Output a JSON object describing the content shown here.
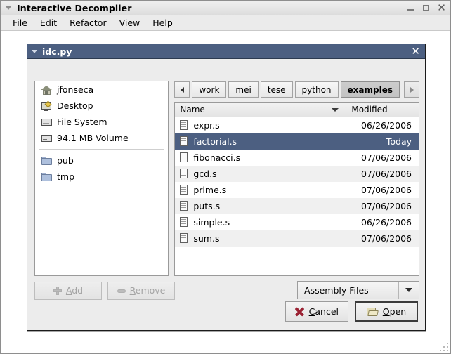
{
  "app": {
    "title": "Interactive Decompiler",
    "menu": [
      {
        "label": "File",
        "mnemonic": "F",
        "rest": "ile"
      },
      {
        "label": "Edit",
        "mnemonic": "E",
        "rest": "dit"
      },
      {
        "label": "Refactor",
        "mnemonic": "R",
        "rest": "efactor"
      },
      {
        "label": "View",
        "mnemonic": "V",
        "rest": "iew"
      },
      {
        "label": "Help",
        "mnemonic": "H",
        "rest": "elp"
      }
    ],
    "window_controls": {
      "minimize": "minimize-button",
      "maximize": "maximize-button",
      "close": "✕"
    }
  },
  "dialog": {
    "title": "idc.py",
    "close_label": "✕",
    "places": [
      {
        "label": "jfonseca",
        "icon": "home-icon"
      },
      {
        "label": "Desktop",
        "icon": "desktop-icon"
      },
      {
        "label": "File System",
        "icon": "filesystem-icon"
      },
      {
        "label": "94.1 MB Volume",
        "icon": "volume-icon"
      },
      {
        "label": "pub",
        "icon": "folder-icon"
      },
      {
        "label": "tmp",
        "icon": "folder-icon"
      }
    ],
    "breadcrumb": {
      "prev_label": "◀",
      "next_label": "▶",
      "crumbs": [
        {
          "label": "work",
          "active": false
        },
        {
          "label": "mei",
          "active": false
        },
        {
          "label": "tese",
          "active": false
        },
        {
          "label": "python",
          "active": false
        },
        {
          "label": "examples",
          "active": true
        }
      ]
    },
    "columns": {
      "name": "Name",
      "modified": "Modified"
    },
    "files": [
      {
        "name": "expr.s",
        "modified": "06/26/2006",
        "selected": false
      },
      {
        "name": "factorial.s",
        "modified": "Today",
        "selected": true
      },
      {
        "name": "fibonacci.s",
        "modified": "07/06/2006",
        "selected": false
      },
      {
        "name": "gcd.s",
        "modified": "07/06/2006",
        "selected": false
      },
      {
        "name": "prime.s",
        "modified": "07/06/2006",
        "selected": false
      },
      {
        "name": "puts.s",
        "modified": "07/06/2006",
        "selected": false
      },
      {
        "name": "simple.s",
        "modified": "06/26/2006",
        "selected": false
      },
      {
        "name": "sum.s",
        "modified": "07/06/2006",
        "selected": false
      }
    ],
    "add_button": {
      "label": "Add",
      "mnemonic": "A",
      "rest": "dd",
      "disabled": true
    },
    "remove_button": {
      "label": "Remove",
      "mnemonic": "R",
      "rest": "emove",
      "disabled": true
    },
    "filter": {
      "selected": "Assembly Files"
    },
    "cancel_button": {
      "label": "Cancel",
      "mnemonic": "C",
      "rest": "ancel"
    },
    "open_button": {
      "label": "Open",
      "mnemonic": "O",
      "rest": "pen"
    }
  },
  "colors": {
    "titlebar_selected": "#4c5f81",
    "row_selected": "#4c5f81",
    "dialog_bg": "#ececec",
    "row_alt": "#f0f0f0"
  }
}
